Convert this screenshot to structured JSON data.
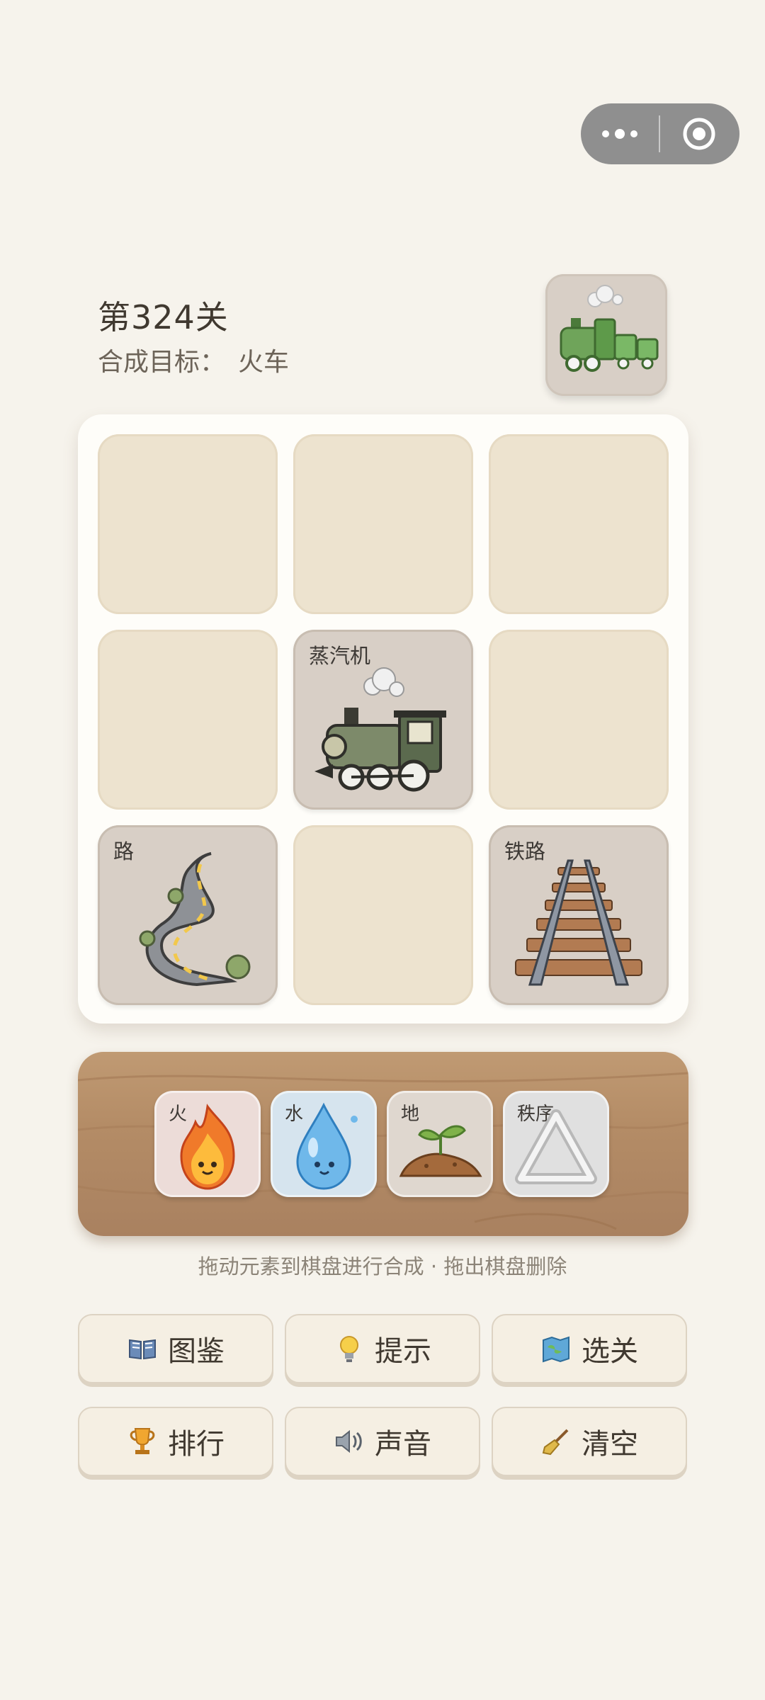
{
  "level": {
    "title": "第324关",
    "goal_label": "合成目标：",
    "goal_value": "火车"
  },
  "target": {
    "icon": "train-icon"
  },
  "board": {
    "cells": [
      {
        "label": ""
      },
      {
        "label": ""
      },
      {
        "label": ""
      },
      {
        "label": ""
      },
      {
        "label": "蒸汽机",
        "icon": "steam-engine-icon"
      },
      {
        "label": ""
      },
      {
        "label": "路",
        "icon": "road-icon"
      },
      {
        "label": ""
      },
      {
        "label": "铁路",
        "icon": "railway-icon"
      }
    ]
  },
  "tray": {
    "elements": [
      {
        "label": "火",
        "icon": "fire-icon",
        "color": "#ecdcd8"
      },
      {
        "label": "水",
        "icon": "water-drop-icon",
        "color": "#d6e4ee"
      },
      {
        "label": "地",
        "icon": "earth-sprout-icon",
        "color": "#dfd7cf"
      },
      {
        "label": "秩序",
        "icon": "triangle-icon",
        "color": "#e0e0e0"
      }
    ]
  },
  "hint": "拖动元素到棋盘进行合成 · 拖出棋盘删除",
  "buttons": [
    {
      "label": "图鉴",
      "icon": "book-icon"
    },
    {
      "label": "提示",
      "icon": "lightbulb-icon"
    },
    {
      "label": "选关",
      "icon": "map-icon"
    },
    {
      "label": "排行",
      "icon": "trophy-icon"
    },
    {
      "label": "声音",
      "icon": "speaker-icon"
    },
    {
      "label": "清空",
      "icon": "broom-icon"
    }
  ]
}
